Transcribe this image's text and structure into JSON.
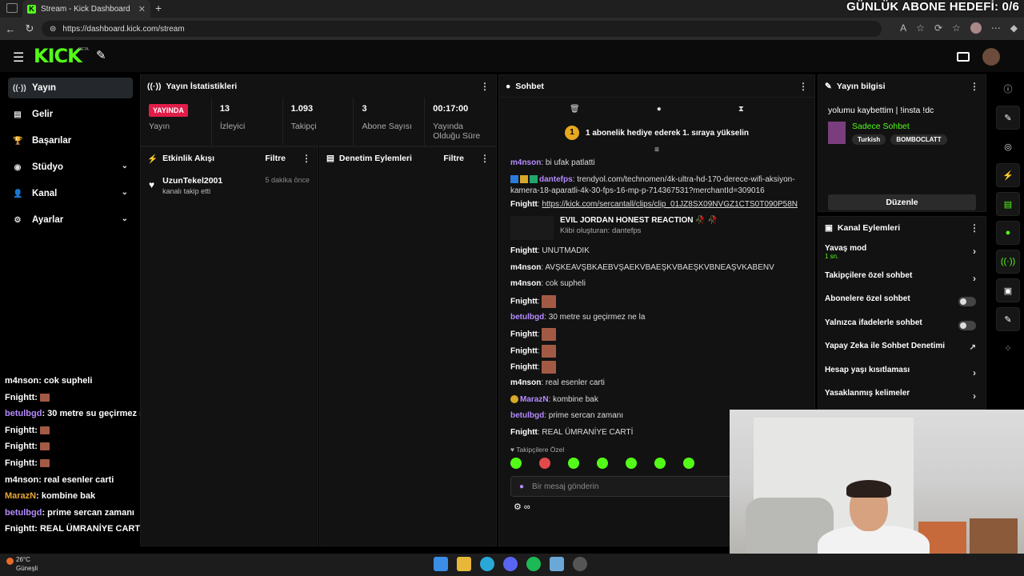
{
  "browser": {
    "tab_title": "Stream - Kick Dashboard",
    "url": "https://dashboard.kick.com/stream",
    "overlay_title": "GÜNLÜK ABONE HEDEFİ: 0/6"
  },
  "brand": {
    "logo": "KICK",
    "beta": "BETA",
    "accent": "#53fc18"
  },
  "sidebar": {
    "items": [
      {
        "label": "Yayın",
        "icon": "broadcast-icon"
      },
      {
        "label": "Gelir",
        "icon": "revenue-icon"
      },
      {
        "label": "Başarılar",
        "icon": "trophy-icon"
      },
      {
        "label": "Stüdyo",
        "icon": "studio-icon"
      },
      {
        "label": "Kanal",
        "icon": "person-icon"
      },
      {
        "label": "Ayarlar",
        "icon": "gear-icon"
      }
    ]
  },
  "stats": {
    "title": "Yayın İstatistikleri",
    "live_badge": "YAYINDA",
    "live_label": "Yayın",
    "viewers": {
      "value": "13",
      "label": "İzleyici"
    },
    "followers": {
      "value": "1.093",
      "label": "Takipçi"
    },
    "subs": {
      "value": "3",
      "label": "Abone Sayısı"
    },
    "uptime": {
      "value": "00:17:00",
      "label": "Yayında Olduğu Süre"
    }
  },
  "activity": {
    "title": "Etkinlik Akışı",
    "filter": "Filtre",
    "items": [
      {
        "name": "UzunTekel2001",
        "sub": "kanalı takip etti",
        "time": "5 dakika önce"
      }
    ]
  },
  "moderation": {
    "title": "Denetim Eylemleri",
    "filter": "Filtre"
  },
  "chat": {
    "title": "Sohbet",
    "gift_coin": "1",
    "gift_text": "1 abonelik hediye ederek 1. sıraya yükselin",
    "m1_user": "m4nson",
    "m1_text": ": bi ufak patlatti",
    "m2_user": "dantefps",
    "m2_text": ": trendyol.com/technomen/4k-ultra-hd-170-derece-wifi-aksiyon-kamera-18-aparatli-4k-30-fps-16-mp-p-714367531?merchantId=309016",
    "m3_user": "Fnightt",
    "m3_link": "https://kick.com/sercantall/clips/clip_01JZ8SX09NVGZ1CTS0T090P58N",
    "clip_title": "EVIL JORDAN HONEST REACTION 🥀 🥀",
    "clip_sub": "Klibi oluşturan: dantefps",
    "m4_user": "Fnightt",
    "m4_text": ": UNUTMADIK",
    "m5_user": "m4nson",
    "m5_text": ": AVŞKEAVŞBKAEBVŞAEKVBAEŞKVBAEŞKVBNEAŞVKABENV",
    "m6_user": "m4nson",
    "m6_text": ": cok supheli",
    "m7_user": "Fnightt",
    "m7_text": ":",
    "m8_user": "betulbgd",
    "m8_text": ": 30 metre su geçirmez ne la",
    "m9_user": "Fnightt",
    "m9_text": ":",
    "m10_user": "Fnightt",
    "m10_text": ":",
    "m11_user": "Fnightt",
    "m11_text": ":",
    "m12_user": "m4nson",
    "m12_text": ": real esenler carti",
    "m13_user": "MarazN",
    "m13_text": ": kombine bak",
    "m14_user": "betulbgd",
    "m14_text": ": prime sercan zamanı",
    "m15_user": "Fnightt",
    "m15_text": ": REAL ÜMRANİYE CARTİ",
    "followers_only": "Takipçilere Özel",
    "input_placeholder": "Bir mesaj gönderin"
  },
  "overlay_chat": [
    {
      "user": "m4nson",
      "text": ": cok supheli"
    },
    {
      "user": "Fnightt",
      "text": ":"
    },
    {
      "user": "betulbgd",
      "text": ": 30 metre su geçirmez ne la"
    },
    {
      "user": "Fnightt",
      "text": ":"
    },
    {
      "user": "Fnightt",
      "text": ":"
    },
    {
      "user": "Fnightt",
      "text": ":"
    },
    {
      "user": "m4nson",
      "text": ": real esenler carti"
    },
    {
      "user": "MarazN",
      "text": ": kombine bak"
    },
    {
      "user": "betulbgd",
      "text": ": prime sercan zamanı"
    },
    {
      "user": "Fnightt",
      "text": ": REAL ÜMRANİYE CARTİ"
    }
  ],
  "info": {
    "title": "Yayın bilgisi",
    "stream_title": "yolumu kaybettim | !insta !dc",
    "category": "Sadece Sohbet",
    "tags": [
      "Turkish",
      "BOMBOCLATT"
    ],
    "edit": "Düzenle"
  },
  "channel_actions": {
    "title": "Kanal Eylemleri",
    "slow_mode": "Yavaş mod",
    "slow_mode_value": "1 sn.",
    "followers_chat": "Takipçilere özel sohbet",
    "subs_chat": "Abonelere özel sohbet",
    "emotes_chat": "Yalnızca ifadelerle sohbet",
    "ai_mod": "Yapay Zeka ile Sohbet Denetimi",
    "age_limit": "Hesap yaşı kısıtlaması",
    "banned_words": "Yasaklanmış kelimeler"
  },
  "taskbar": {
    "temp": "26°C",
    "place": "Güneşli"
  }
}
